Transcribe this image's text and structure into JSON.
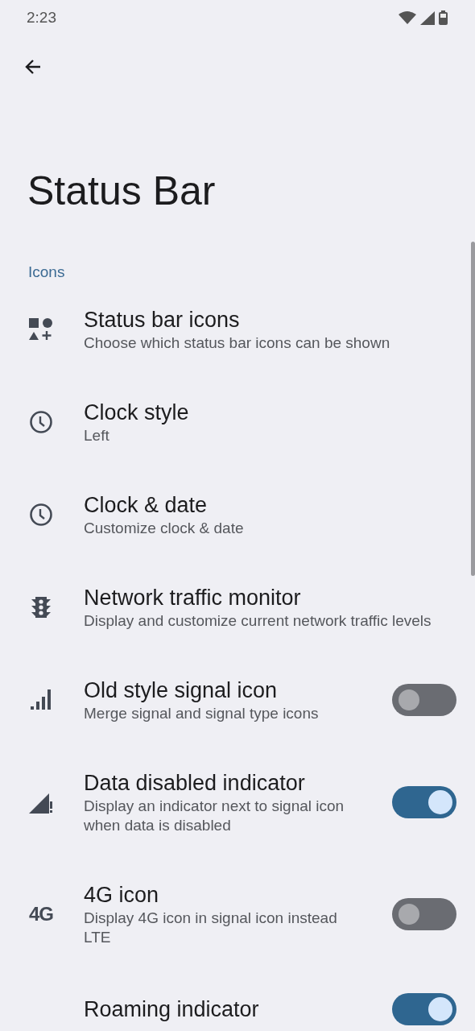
{
  "status_bar": {
    "time": "2:23"
  },
  "title": "Status Bar",
  "section": "Icons",
  "items": [
    {
      "title": "Status bar icons",
      "summary": "Choose which status bar icons can be shown"
    },
    {
      "title": "Clock style",
      "summary": "Left"
    },
    {
      "title": "Clock & date",
      "summary": "Customize clock & date"
    },
    {
      "title": "Network traffic monitor",
      "summary": "Display and customize current network traffic levels"
    },
    {
      "title": "Old style signal icon",
      "summary": "Merge signal and signal type icons",
      "kind": "switch",
      "on": false
    },
    {
      "title": "Data disabled indicator",
      "summary": "Display an indicator next to signal icon when data is disabled",
      "kind": "switch",
      "on": true
    },
    {
      "icon_text": "4G",
      "title": "4G icon",
      "summary": "Display 4G icon in signal icon instead LTE",
      "kind": "switch",
      "on": false
    },
    {
      "title": "Roaming indicator",
      "kind": "switch",
      "on": true
    }
  ]
}
